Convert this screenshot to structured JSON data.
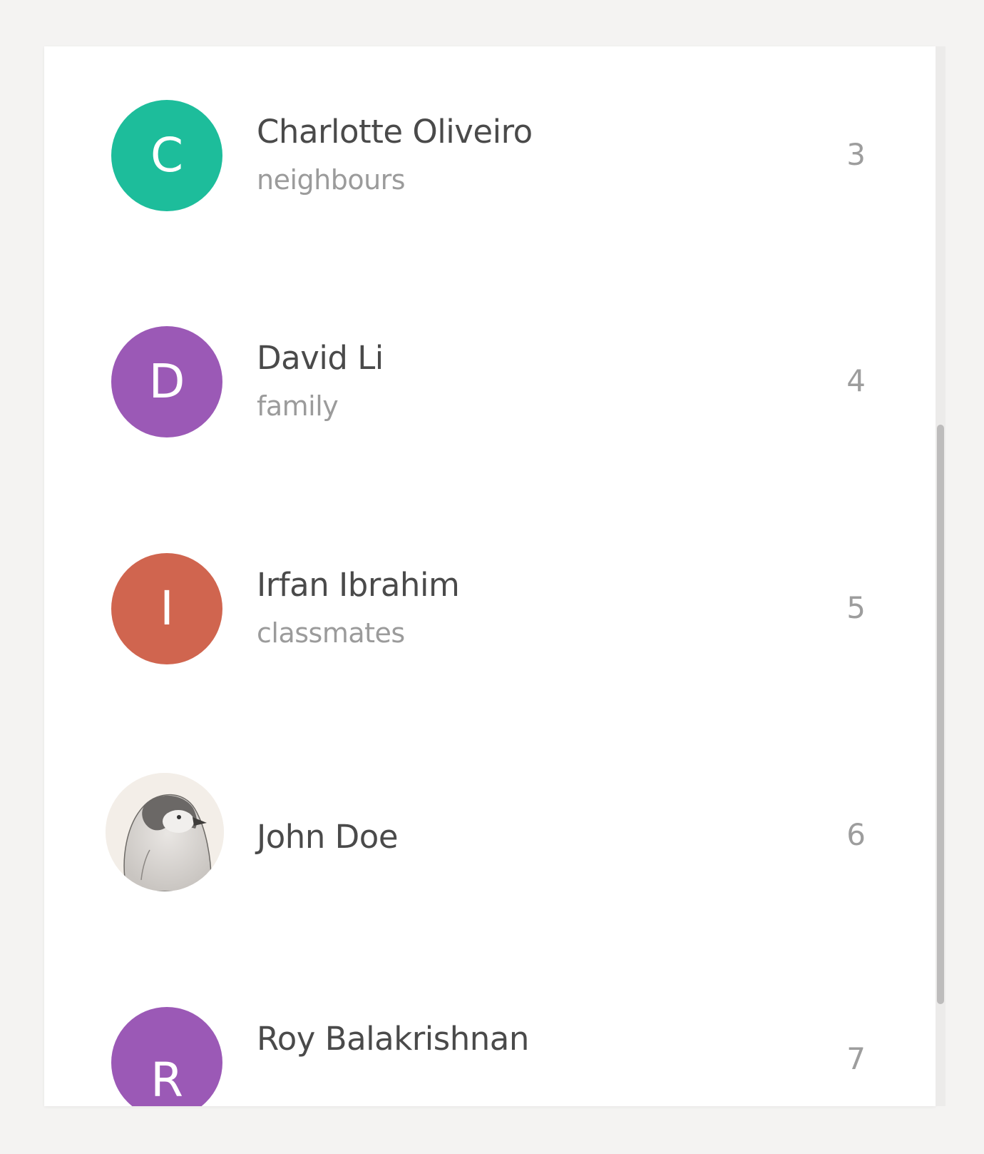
{
  "contacts": [
    {
      "initial": "C",
      "name": "Charlotte Oliveiro",
      "group": "neighbours",
      "count": "3",
      "color": "#1dbd9b"
    },
    {
      "initial": "D",
      "name": "David Li",
      "group": "family",
      "count": "4",
      "color": "#9b59b6"
    },
    {
      "initial": "I",
      "name": "Irfan Ibrahim",
      "group": "classmates",
      "count": "5",
      "color": "#d0654f"
    },
    {
      "initial": "",
      "name": "John Doe",
      "group": "",
      "count": "6",
      "avatar_icon": "penguin-avatar-icon"
    },
    {
      "initial": "R",
      "name": "Roy Balakrishnan",
      "group": "",
      "count": "7",
      "color": "#9b59b6"
    }
  ]
}
